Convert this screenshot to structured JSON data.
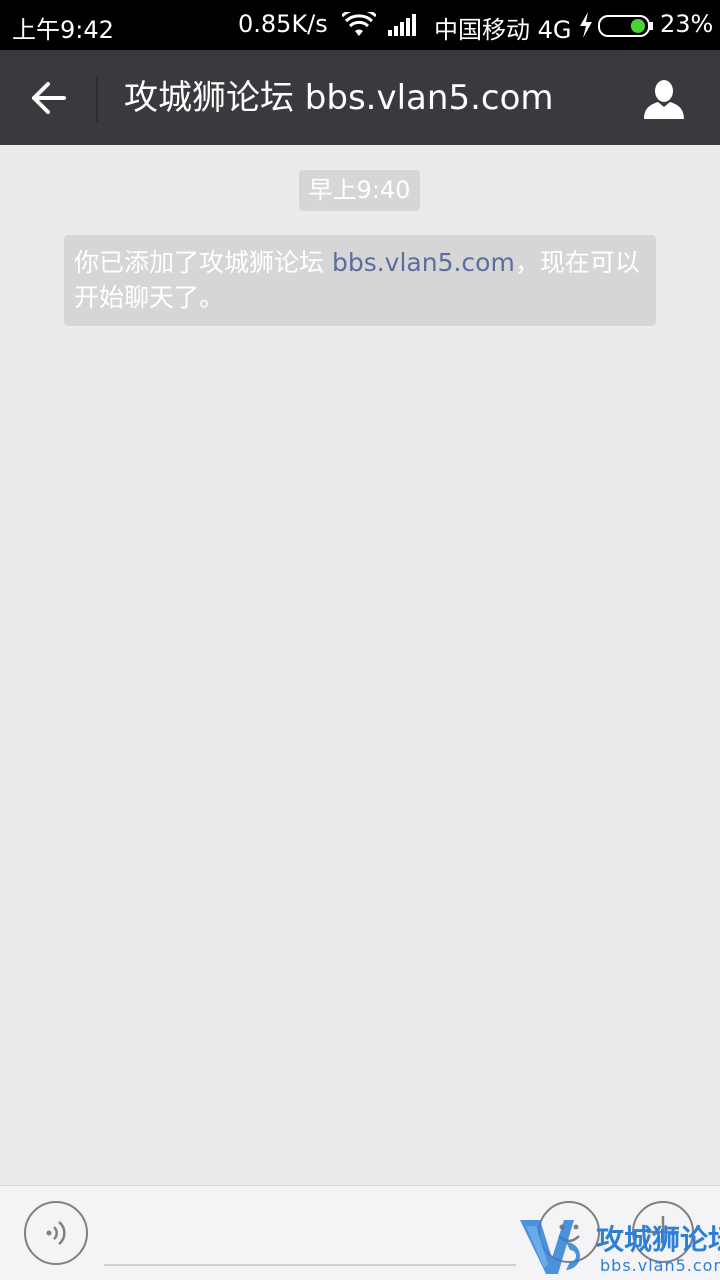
{
  "status_bar": {
    "time": "上午9:42",
    "net_speed": "0.85K/s",
    "carrier": "中国移动 4G",
    "battery_pct": "23%",
    "battery_level": 0.23,
    "wifi_icon": "wifi-icon",
    "signal_icon": "signal-icon",
    "charging_icon": "bolt-icon"
  },
  "header": {
    "title": "攻城狮论坛 bbs.vlan5.com",
    "back_icon": "arrow-left-icon",
    "profile_icon": "person-icon",
    "bg_color": "#393a3e"
  },
  "chat": {
    "time_label": "早上9:40",
    "system_message": {
      "prefix": "你已添加了攻城狮论坛 ",
      "link": "bbs.vlan5.com",
      "suffix": "，现在可以开始聊天了。"
    },
    "link_color": "#5b6e9c"
  },
  "input_bar": {
    "text_value": "",
    "voice_icon": "voice-icon",
    "emoji_icon": "emoji-icon",
    "plus_icon": "plus-icon"
  },
  "watermark": {
    "title": "攻城狮论坛",
    "subtitle": "bbs.vlan5.com",
    "color": "#2f7fd6"
  }
}
